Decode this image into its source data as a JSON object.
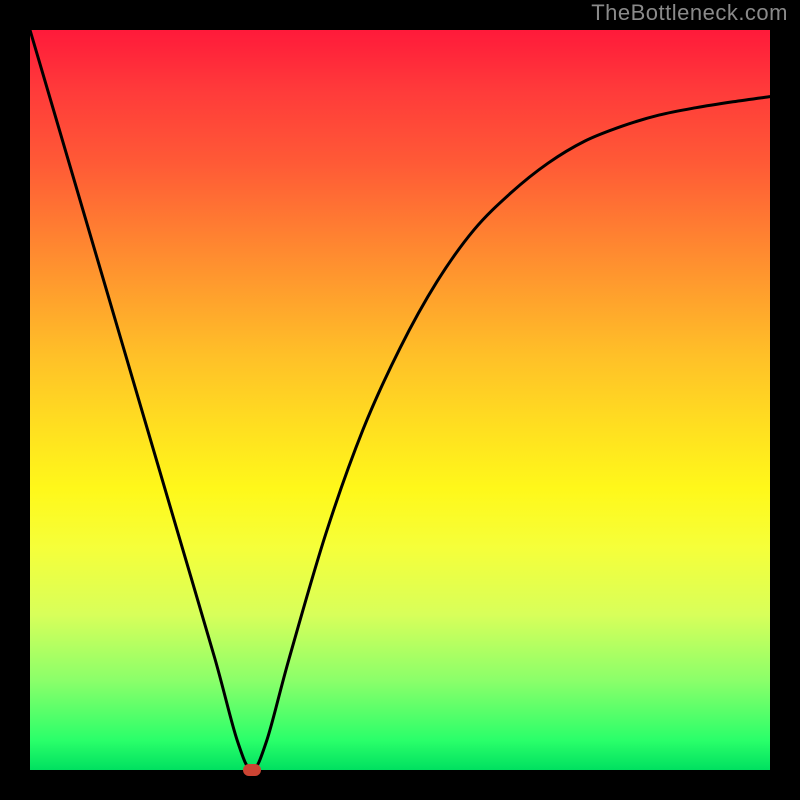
{
  "watermark": "TheBottleneck.com",
  "chart_data": {
    "type": "line",
    "title": "",
    "xlabel": "",
    "ylabel": "",
    "xlim": [
      0,
      100
    ],
    "ylim": [
      0,
      100
    ],
    "series": [
      {
        "name": "curve",
        "x": [
          0,
          5,
          10,
          15,
          20,
          25,
          28,
          30,
          32,
          35,
          40,
          45,
          50,
          55,
          60,
          65,
          70,
          75,
          80,
          85,
          90,
          95,
          100
        ],
        "values": [
          100,
          83,
          66,
          49,
          32,
          15,
          4,
          0,
          4,
          15,
          32,
          46,
          57,
          66,
          73,
          78,
          82,
          85,
          87,
          88.5,
          89.5,
          90.3,
          91
        ]
      }
    ],
    "marker": {
      "x": 30,
      "y": 0
    },
    "gradient_stops": [
      {
        "pos": 0,
        "color": "#ff1a3a"
      },
      {
        "pos": 50,
        "color": "#ffe020"
      },
      {
        "pos": 100,
        "color": "#00e060"
      }
    ]
  }
}
